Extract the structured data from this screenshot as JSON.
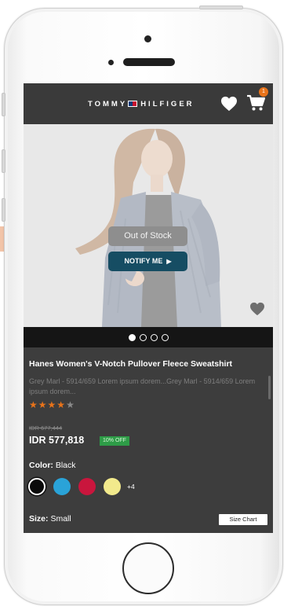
{
  "header": {
    "brand_left": "TOMMY",
    "brand_right": "HILFIGER",
    "cart_count": "1"
  },
  "hero": {
    "out_of_stock_label": "Out of Stock",
    "notify_label": "NOTIFY ME",
    "carousel": {
      "total": 4,
      "active_index": 0
    }
  },
  "product": {
    "title": "Hanes Women's V-Notch Pullover Fleece Sweatshirt",
    "description": "Grey Marl - 5914/659 Lorem ipsum dorem...Grey Marl - 5914/659 Lorem ipsum dorem...",
    "rating": 4,
    "rating_max": 5,
    "old_price": "IDR 677,444",
    "price": "IDR 577,818",
    "discount": "10% OFF",
    "color_label": "Color:",
    "color_value": "Black",
    "swatches": [
      "#0a0a0a",
      "#2aa3d8",
      "#c9163d",
      "#f2ea8c"
    ],
    "more_colors": "+4",
    "size_label": "Size:",
    "size_value": "Small",
    "size_chart_label": "Size Chart"
  },
  "colors": {
    "accent_orange": "#e8731a",
    "notify_teal": "#164d63",
    "discount_green": "#2e9c47",
    "screen_dark": "#3b3b3b"
  }
}
